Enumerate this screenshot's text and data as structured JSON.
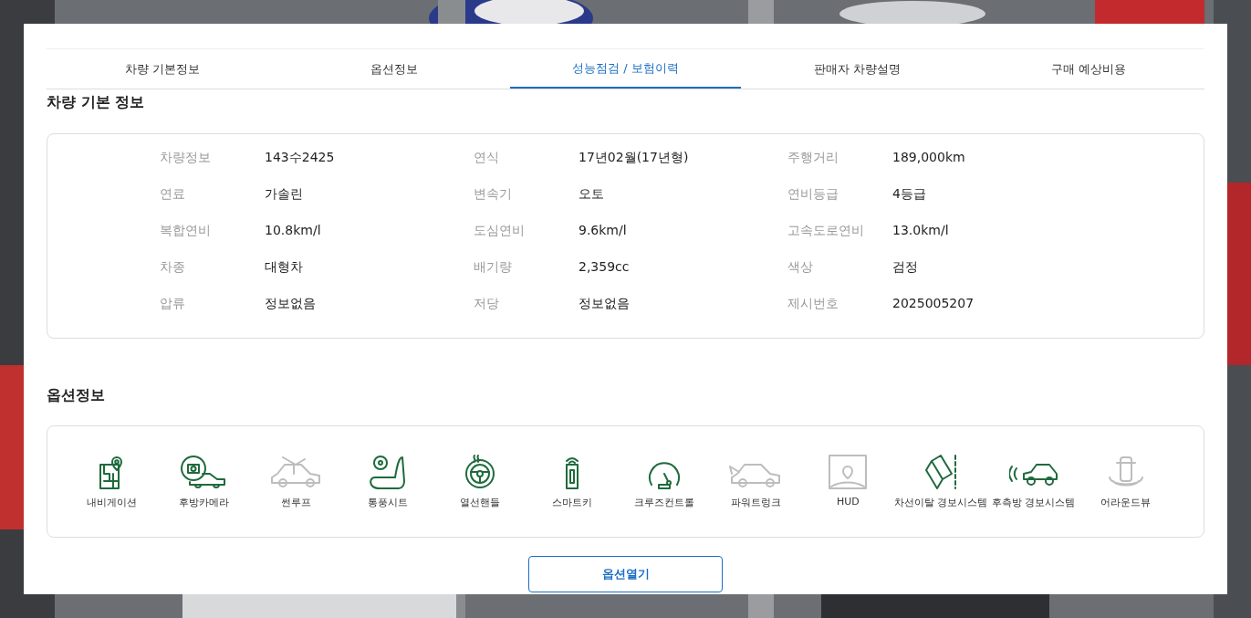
{
  "tabs": [
    {
      "label": "차량 기본정보",
      "selected": false
    },
    {
      "label": "옵션정보",
      "selected": false
    },
    {
      "label": "성능점검 / 보험이력",
      "selected": true
    },
    {
      "label": "판매자 차량설명",
      "selected": false
    },
    {
      "label": "구매 예상비용",
      "selected": false
    }
  ],
  "basic_info": {
    "title": "차량 기본 정보",
    "fields": [
      {
        "label": "차량정보",
        "value": "143수2425"
      },
      {
        "label": "연식",
        "value": "17년02월(17년형)"
      },
      {
        "label": "주행거리",
        "value": "189,000km"
      },
      {
        "label": "연료",
        "value": "가솔린"
      },
      {
        "label": "변속기",
        "value": "오토"
      },
      {
        "label": "연비등급",
        "value": "4등급"
      },
      {
        "label": "복합연비",
        "value": "10.8km/l"
      },
      {
        "label": "도심연비",
        "value": "9.6km/l"
      },
      {
        "label": "고속도로연비",
        "value": "13.0km/l"
      },
      {
        "label": "차종",
        "value": "대형차"
      },
      {
        "label": "배기량",
        "value": "2,359cc"
      },
      {
        "label": "색상",
        "value": "검정"
      },
      {
        "label": "압류",
        "value": "정보없음"
      },
      {
        "label": "저당",
        "value": "정보없음"
      },
      {
        "label": "제시번호",
        "value": "2025005207"
      }
    ]
  },
  "options": {
    "title": "옵션정보",
    "items": [
      {
        "kind": "map",
        "label": "내비게이션",
        "available": true
      },
      {
        "kind": "camera",
        "label": "후방카메라",
        "available": true
      },
      {
        "kind": "sunroof",
        "label": "썬루프",
        "available": false
      },
      {
        "kind": "seat",
        "label": "통풍시트",
        "available": true
      },
      {
        "kind": "wheel",
        "label": "열선핸들",
        "available": true
      },
      {
        "kind": "key",
        "label": "스마트키",
        "available": true
      },
      {
        "kind": "gauge",
        "label": "크루즈컨트롤",
        "available": true
      },
      {
        "kind": "trunk",
        "label": "파워트렁크",
        "available": false
      },
      {
        "kind": "hud",
        "label": "HUD",
        "available": false
      },
      {
        "kind": "lane",
        "label": "차선이탈 경보시스템",
        "available": true
      },
      {
        "kind": "radar",
        "label": "후측방 경보시스템",
        "available": true
      },
      {
        "kind": "around",
        "label": "어라운드뷰",
        "available": false
      }
    ],
    "button": "옵션열기"
  }
}
